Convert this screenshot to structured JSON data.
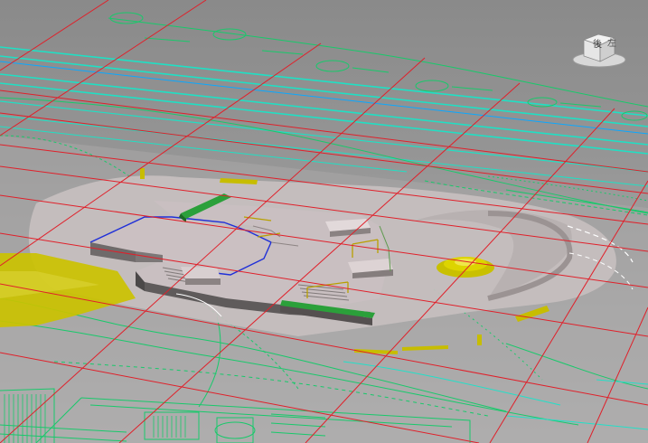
{
  "viewcube": {
    "face_left": "後",
    "face_right": "左",
    "icon": "viewcube-icon"
  },
  "colors": {
    "background": "#959595",
    "grid": "#e0202a",
    "survey_cyan": "#22e0c8",
    "survey_green": "#17c96a",
    "terrain": "#c4bcbc",
    "platform": "#c9bfc1",
    "edge_blue": "#2030d8",
    "ramp_green": "#2aa13a",
    "yellow": "#c8c200"
  },
  "grid_icon": "perspective-grid",
  "model_icon": "skatepark-3d-model"
}
